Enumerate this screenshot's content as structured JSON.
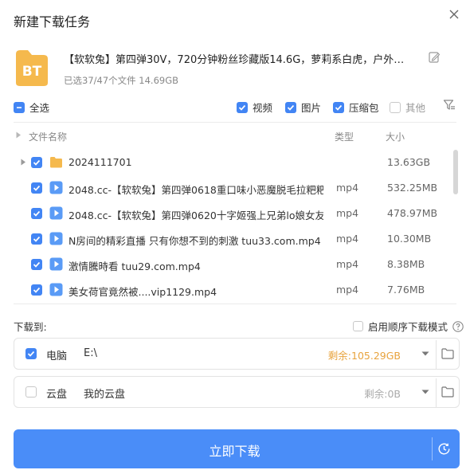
{
  "dialog": {
    "title": "新建下载任务"
  },
  "task": {
    "badge": "BT",
    "name": "【软软兔】第四弹30V，720分钟粉丝珍藏版14.6G，萝莉系白虎，户外…",
    "meta": "已选37/47个文件 14.69GB"
  },
  "filters": {
    "select_all": "全选",
    "video": "视频",
    "image": "图片",
    "archive": "压缩包",
    "other": "其他"
  },
  "columns": {
    "name": "文件名称",
    "type": "类型",
    "size": "大小"
  },
  "files": [
    {
      "name": "2024111701",
      "type": "",
      "size": "13.63GB",
      "kind": "folder"
    },
    {
      "name": "2048.cc-【软软兔】第四弹0618重口味小恶魔脱毛拉粑粑...",
      "type": "mp4",
      "size": "532.25MB",
      "kind": "video"
    },
    {
      "name": "2048.cc-【软软兔】第四弹0620十字姬强上兄弟lo娘女友...",
      "type": "mp4",
      "size": "478.97MB",
      "kind": "video"
    },
    {
      "name": "N房间的精彩直播 只有你想不到的刺激 tuu33.com.mp4",
      "type": "mp4",
      "size": "10.30MB",
      "kind": "video"
    },
    {
      "name": "激情騰時看 tuu29.com.mp4",
      "type": "mp4",
      "size": "8.38MB",
      "kind": "video"
    },
    {
      "name": "美女荷官竟然被....vip1129.mp4",
      "type": "mp4",
      "size": "7.76MB",
      "kind": "video"
    }
  ],
  "save_to": {
    "label": "下载到:",
    "sequential_mode": "启用顺序下载模式",
    "targets": [
      {
        "name": "电脑",
        "path": "E:\\",
        "free": "剩余:105.29GB",
        "free_color": "#e8a33d",
        "checked": true
      },
      {
        "name": "云盘",
        "path": "我的云盘",
        "free": "剩余:0B",
        "free_color": "#aaaaaa",
        "checked": false
      }
    ]
  },
  "actions": {
    "download_now": "立即下载"
  },
  "colors": {
    "accent": "#4a8df8",
    "bt_badge": "#f5b94d",
    "checkbox": "#4285f4"
  }
}
